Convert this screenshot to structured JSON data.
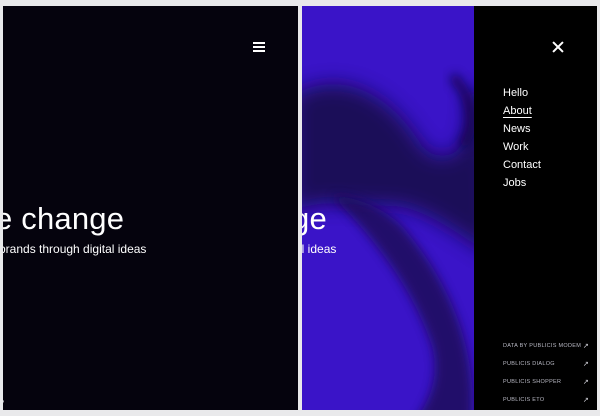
{
  "hero": {
    "heading_left": "e change",
    "subtitle_left": "brands through digital ideas",
    "heading_right": "ge",
    "subtitle_right": "al ideas"
  },
  "left_frame": {
    "menu_icon": "hamburger-icon",
    "corner_mark": "y"
  },
  "menu": {
    "close_icon": "close-icon",
    "items": [
      {
        "label": "Hello",
        "active": false
      },
      {
        "label": "About",
        "active": true
      },
      {
        "label": "News",
        "active": false
      },
      {
        "label": "Work",
        "active": false
      },
      {
        "label": "Contact",
        "active": false
      },
      {
        "label": "Jobs",
        "active": false
      }
    ],
    "external_links": [
      {
        "label": "DATA BY PUBLICIS MODEM",
        "icon": "external-arrow-icon"
      },
      {
        "label": "PUBLICIS DIALOG",
        "icon": "external-arrow-icon"
      },
      {
        "label": "PUBLICIS SHOPPER",
        "icon": "external-arrow-icon"
      },
      {
        "label": "PUBLICIS ETO",
        "icon": "external-arrow-icon"
      }
    ]
  },
  "colors": {
    "dark_background": "#05030d",
    "purple_background": "#3a14c8",
    "menu_background": "#000000",
    "text": "#ffffff"
  }
}
